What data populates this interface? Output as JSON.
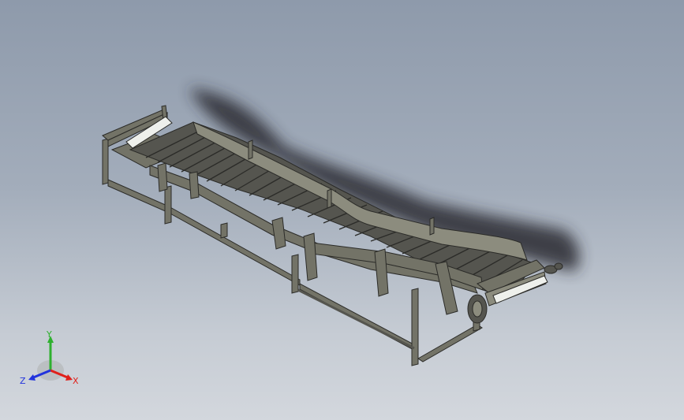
{
  "viewport": {
    "background_top": "#8e9aab",
    "background_bottom": "#d3d7dd"
  },
  "model": {
    "kind": "inclined-belt-conveyor",
    "frame_color": "#737367",
    "belt_color": "#55554f",
    "edge_color": "#2b2b28",
    "shadow_color": "#2a2c30",
    "roller_color": "#eef0ec"
  },
  "triad": {
    "x_label": "X",
    "y_label": "Y",
    "z_label": "Z",
    "x_color": "#e0201a",
    "y_color": "#2eb02e",
    "z_color": "#2233dd"
  }
}
